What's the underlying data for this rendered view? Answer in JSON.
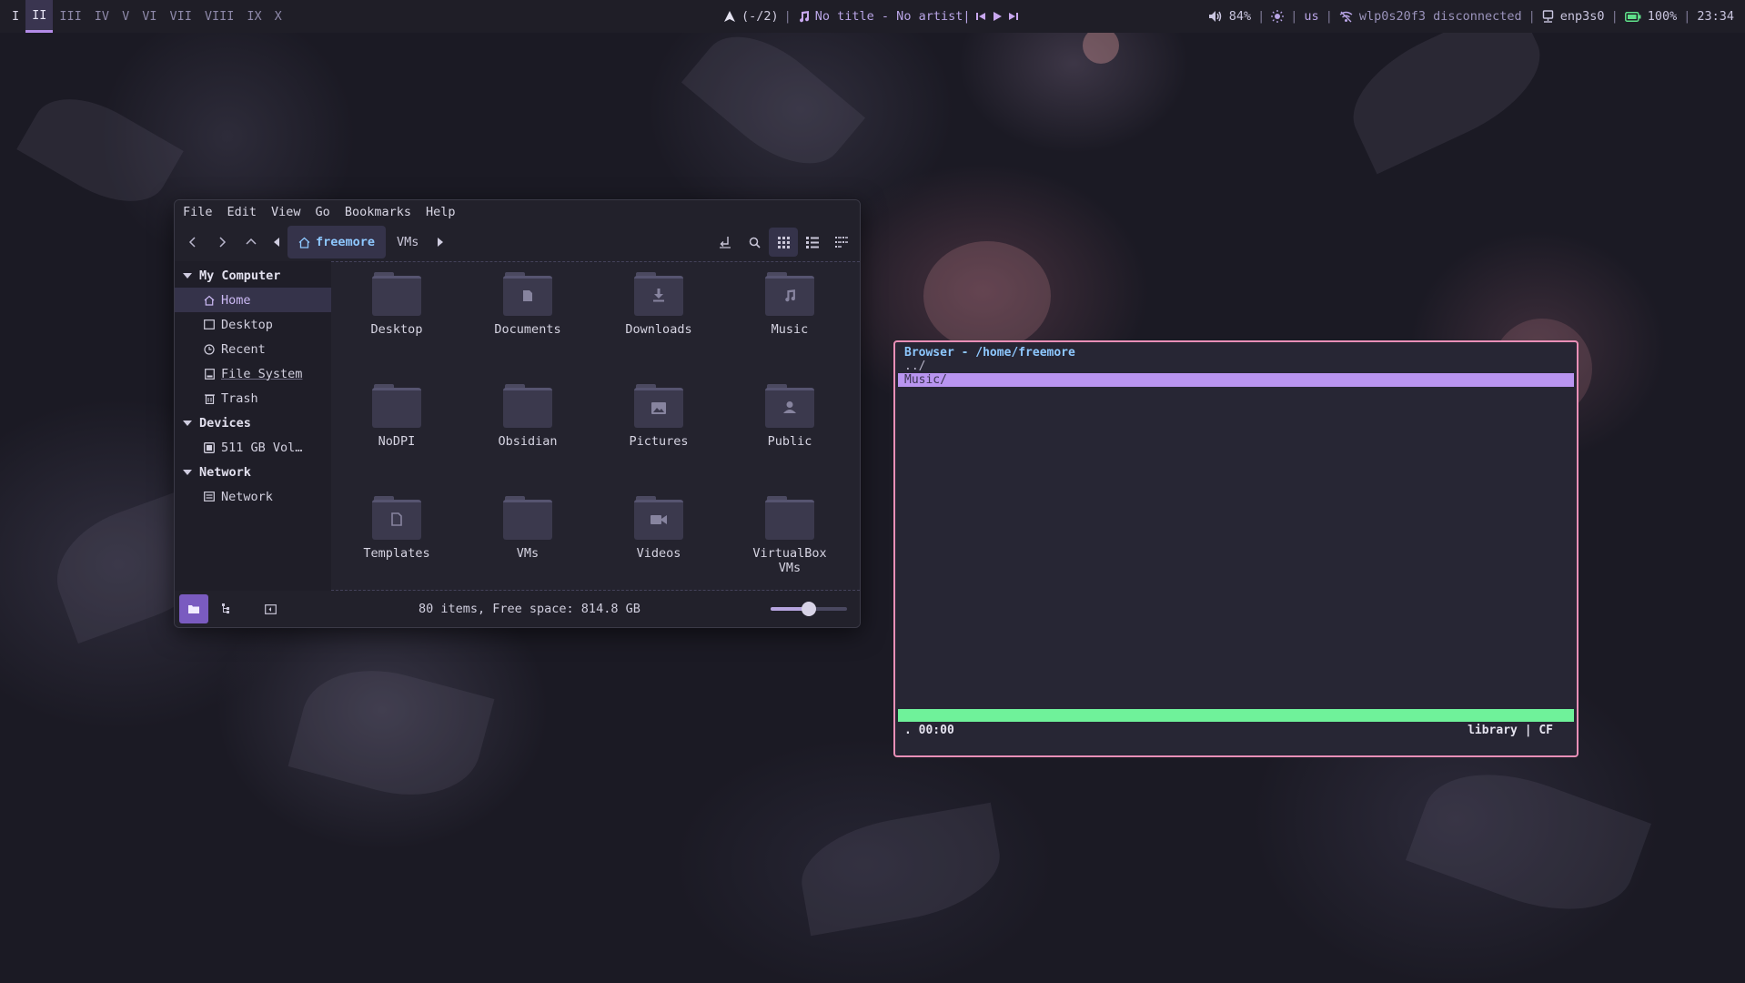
{
  "topbar": {
    "workspaces": [
      "I",
      "II",
      "III",
      "IV",
      "V",
      "VI",
      "VII",
      "VIII",
      "IX",
      "X"
    ],
    "active_workspace": "II",
    "window_count": "(-/2)",
    "media_text": "No title - No artist|",
    "volume": "84%",
    "keyboard_layout": "us",
    "wifi": "wlp0s20f3 disconnected",
    "ethernet": "enp3s0",
    "battery": "100%",
    "clock": "23:34",
    "separator": "|"
  },
  "filemanager": {
    "menu": [
      "File",
      "Edit",
      "View",
      "Go",
      "Bookmarks",
      "Help"
    ],
    "breadcrumb_current": "freemore",
    "breadcrumb_next": "VMs",
    "sidebar": {
      "my_computer": "My Computer",
      "items": [
        "Home",
        "Desktop",
        "Recent",
        "File System",
        "Trash"
      ],
      "devices": "Devices",
      "device_items": [
        "511 GB Vol…"
      ],
      "network": "Network",
      "network_items": [
        "Network"
      ]
    },
    "folders": [
      "Desktop",
      "Documents",
      "Downloads",
      "Music",
      "NoDPI",
      "Obsidian",
      "Pictures",
      "Public",
      "Templates",
      "VMs",
      "Videos",
      "VirtualBox VMs"
    ],
    "status": "80 items, Free space: 814.8 GB",
    "zoom_level": 0.5
  },
  "terminal": {
    "title": "Browser - /home/freemore",
    "parent": "../",
    "selected": "Music/",
    "time": ". 00:00",
    "mode": "library | CF"
  },
  "colors": {
    "accent_purple": "#b995f0",
    "accent_pink": "#e88fb7",
    "accent_green": "#6ff29a",
    "link_blue": "#8ec8ff"
  }
}
